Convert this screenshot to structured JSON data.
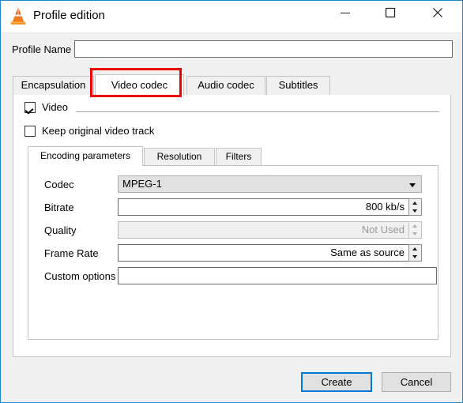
{
  "window": {
    "title": "Profile edition",
    "icon": "vlc-cone-icon",
    "accent_color": "#1f86d0",
    "controls": [
      {
        "name": "minimize-button",
        "glyph": "minimize-icon"
      },
      {
        "name": "maximize-button",
        "glyph": "maximize-icon"
      },
      {
        "name": "close-button",
        "glyph": "close-icon"
      }
    ]
  },
  "profile": {
    "label": "Profile Name",
    "value": "",
    "placeholder": ""
  },
  "outer_tabs": {
    "active_index": 1,
    "items": [
      {
        "label": "Encapsulation"
      },
      {
        "label": "Video codec"
      },
      {
        "label": "Audio codec"
      },
      {
        "label": "Subtitles"
      }
    ]
  },
  "video_group": {
    "video_checkbox": {
      "label": "Video",
      "checked": true
    },
    "keep_track_checkbox": {
      "label": "Keep original video track",
      "checked": false
    }
  },
  "inner_tabs": {
    "active_index": 0,
    "items": [
      {
        "label": "Encoding parameters"
      },
      {
        "label": "Resolution"
      },
      {
        "label": "Filters"
      }
    ]
  },
  "encoding_form": {
    "codec": {
      "label": "Codec",
      "value": "MPEG-1",
      "control": "combobox"
    },
    "bitrate": {
      "label": "Bitrate",
      "value": "800 kb/s",
      "control": "spinbox",
      "enabled": true
    },
    "quality": {
      "label": "Quality",
      "value": "Not Used",
      "control": "spinbox",
      "enabled": false
    },
    "frame_rate": {
      "label": "Frame Rate",
      "value": "Same as source",
      "control": "spinbox",
      "enabled": true
    },
    "custom_options": {
      "label": "Custom options",
      "value": "",
      "placeholder": "",
      "control": "textfield"
    }
  },
  "highlight": {
    "color": "#ee0000",
    "target": "Video codec"
  },
  "footer": {
    "create_label": "Create",
    "cancel_label": "Cancel",
    "default_button": "Create"
  }
}
